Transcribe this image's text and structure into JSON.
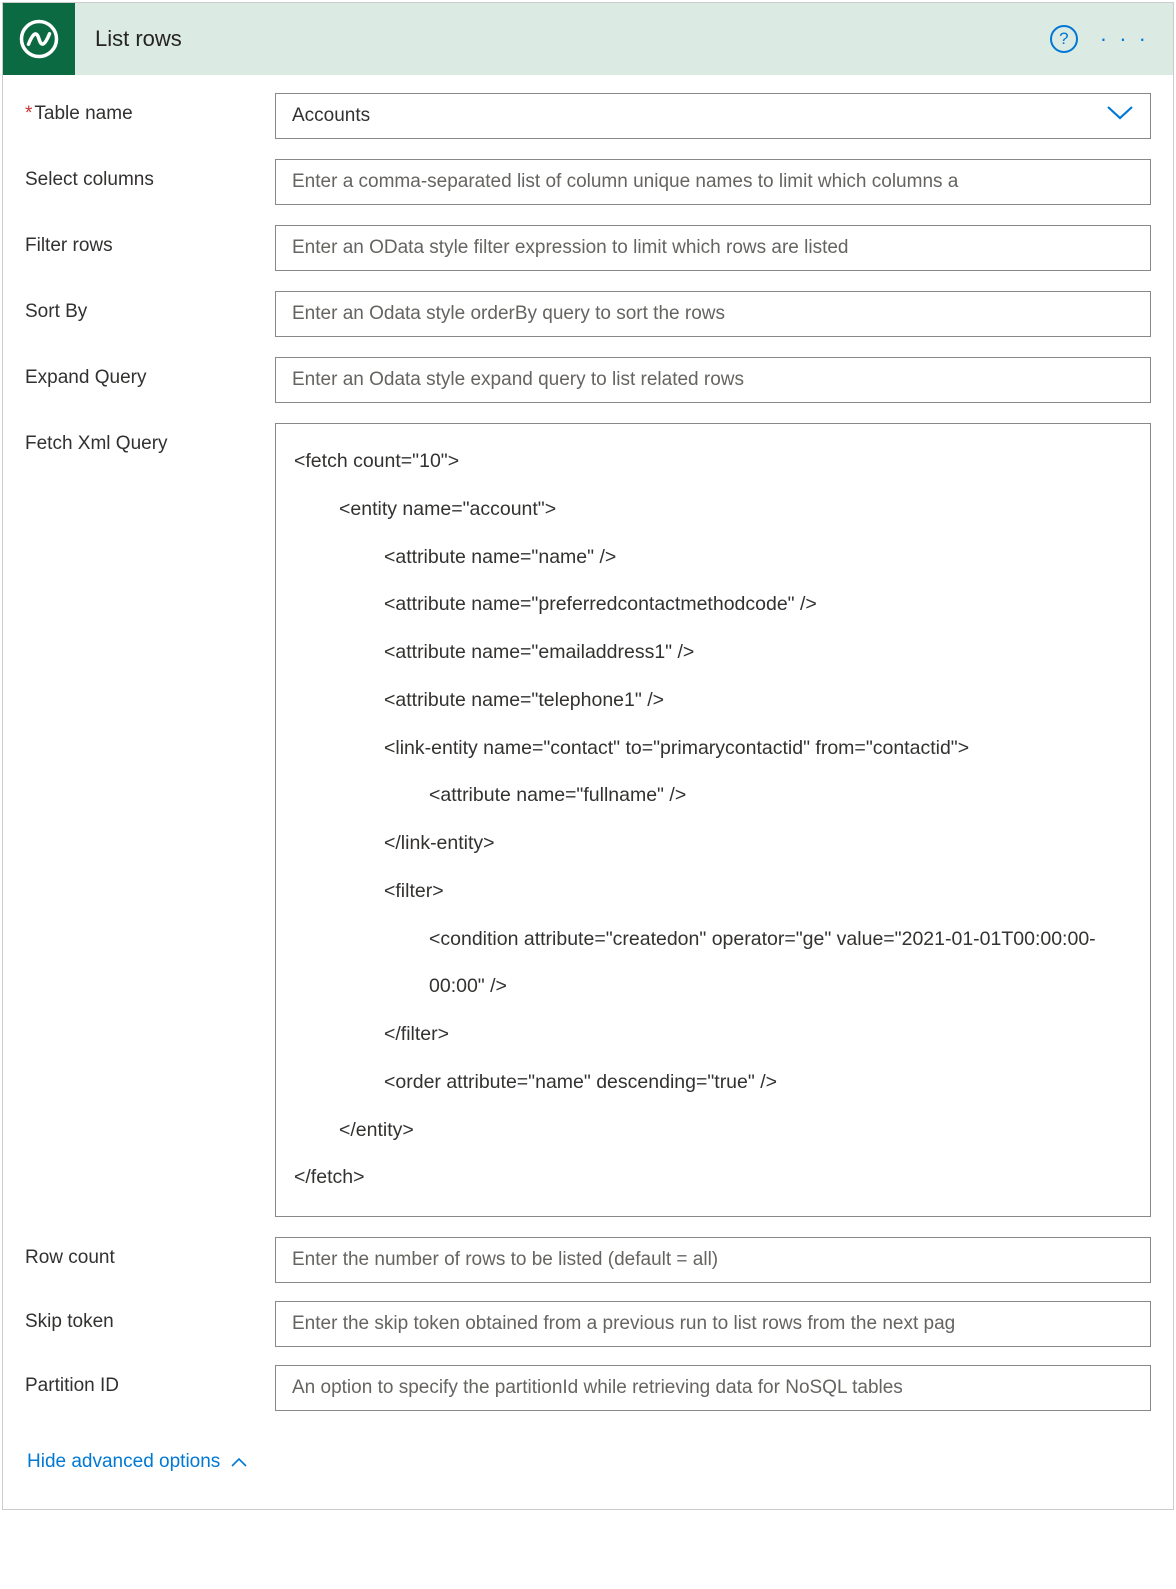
{
  "header": {
    "title": "List rows"
  },
  "fields": {
    "table_name": {
      "label": "Table name",
      "value": "Accounts",
      "required": true
    },
    "select_columns": {
      "label": "Select columns",
      "placeholder": "Enter a comma-separated list of column unique names to limit which columns a"
    },
    "filter_rows": {
      "label": "Filter rows",
      "placeholder": "Enter an OData style filter expression to limit which rows are listed"
    },
    "sort_by": {
      "label": "Sort By",
      "placeholder": "Enter an Odata style orderBy query to sort the rows"
    },
    "expand_query": {
      "label": "Expand Query",
      "placeholder": "Enter an Odata style expand query to list related rows"
    },
    "fetch_xml": {
      "label": "Fetch Xml Query",
      "lines": [
        {
          "i": 0,
          "t": "<fetch count=\"10\">"
        },
        {
          "i": 1,
          "t": "<entity name=\"account\">"
        },
        {
          "i": 2,
          "t": "<attribute name=\"name\" />"
        },
        {
          "i": 2,
          "t": "<attribute name=\"preferredcontactmethodcode\" />"
        },
        {
          "i": 2,
          "t": "<attribute name=\"emailaddress1\" />"
        },
        {
          "i": 2,
          "t": "<attribute name=\"telephone1\" />"
        },
        {
          "i": 2,
          "t": "<link-entity name=\"contact\" to=\"primarycontactid\" from=\"contactid\">"
        },
        {
          "i": 3,
          "t": "<attribute name=\"fullname\" />"
        },
        {
          "i": 2,
          "t": "</link-entity>"
        },
        {
          "i": 2,
          "t": "<filter>"
        },
        {
          "i": 3,
          "t": "<condition attribute=\"createdon\" operator=\"ge\" value=\"2021-01-01T00:00:00-00:00\" />"
        },
        {
          "i": 2,
          "t": "</filter>"
        },
        {
          "i": 2,
          "t": "<order attribute=\"name\" descending=\"true\" />"
        },
        {
          "i": 1,
          "t": "</entity>"
        },
        {
          "i": 0,
          "t": "</fetch>"
        }
      ]
    },
    "row_count": {
      "label": "Row count",
      "placeholder": "Enter the number of rows to be listed (default = all)"
    },
    "skip_token": {
      "label": "Skip token",
      "placeholder": "Enter the skip token obtained from a previous run to list rows from the next pag"
    },
    "partition_id": {
      "label": "Partition ID",
      "placeholder": "An option to specify the partitionId while retrieving data for NoSQL tables"
    }
  },
  "footer": {
    "toggle_label": "Hide advanced options"
  }
}
